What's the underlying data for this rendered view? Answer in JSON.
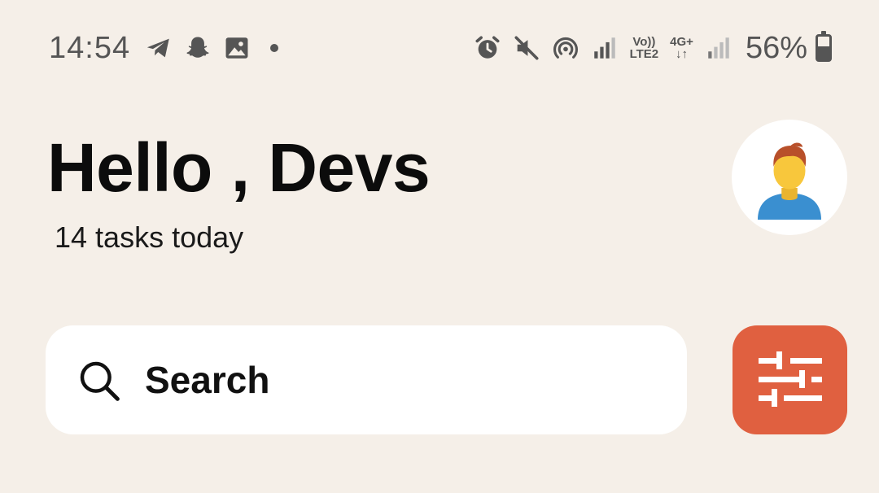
{
  "status_bar": {
    "time": "14:54",
    "left_icons": [
      "telegram-icon",
      "snapchat-icon",
      "gallery-icon",
      "notification-dot-icon"
    ],
    "right_icons": [
      "alarm-icon",
      "mute-icon",
      "hotspot-icon",
      "signal-icon",
      "volte-icon",
      "network-4g-icon",
      "signal-weak-icon",
      "battery-icon"
    ],
    "volte_label_top": "Vo))",
    "volte_label_bottom": "LTE2",
    "network_label_top": "4G+",
    "network_label_bottom": "↓↑",
    "battery_percent_text": "56%",
    "battery_level": 0.56
  },
  "header": {
    "greeting": "Hello , Devs",
    "subtitle": "14 tasks today",
    "avatar_icon": "user-avatar-icon"
  },
  "search": {
    "placeholder": "Search",
    "icon": "search-icon"
  },
  "filter": {
    "icon": "sliders-icon",
    "color": "#E06040"
  },
  "colors": {
    "background": "#F5EFE8",
    "surface": "#FFFFFF",
    "accent": "#E06040"
  }
}
